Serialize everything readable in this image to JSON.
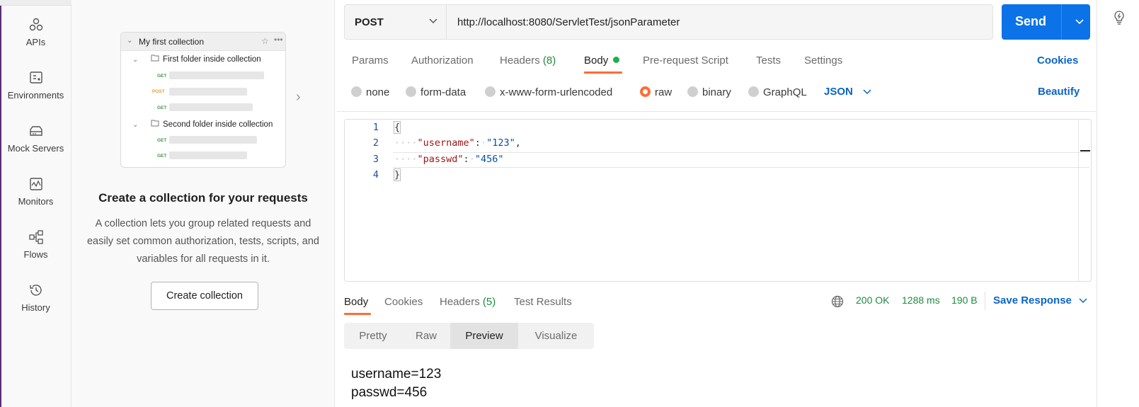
{
  "sidebar": {
    "items": [
      {
        "label": "APIs",
        "icon": "apis-icon"
      },
      {
        "label": "Environments",
        "icon": "environments-icon"
      },
      {
        "label": "Mock Servers",
        "icon": "mock-servers-icon"
      },
      {
        "label": "Monitors",
        "icon": "monitors-icon"
      },
      {
        "label": "Flows",
        "icon": "flows-icon"
      },
      {
        "label": "History",
        "icon": "history-icon"
      }
    ]
  },
  "collection_panel": {
    "illustration": {
      "collection_name": "My first collection",
      "folder1": "First folder inside collection",
      "folder2": "Second folder inside collection",
      "methods": [
        "GET",
        "POST",
        "GET",
        "GET",
        "GET"
      ]
    },
    "title": "Create a collection for your requests",
    "description": "A collection lets you group related requests and easily set common authorization, tests, scripts, and variables for all requests in it.",
    "create_button": "Create collection"
  },
  "request": {
    "method": "POST",
    "url": "http://localhost:8080/ServletTest/jsonParameter",
    "send_label": "Send",
    "tabs": {
      "params": "Params",
      "authorization": "Authorization",
      "headers": "Headers",
      "headers_count": "(8)",
      "body": "Body",
      "pre_request": "Pre-request Script",
      "tests": "Tests",
      "settings": "Settings"
    },
    "cookies_label": "Cookies",
    "body_types": {
      "none": "none",
      "form_data": "form-data",
      "urlencoded": "x-www-form-urlencoded",
      "raw": "raw",
      "binary": "binary",
      "graphql": "GraphQL",
      "selected": "raw"
    },
    "format": "JSON",
    "beautify_label": "Beautify",
    "editor": {
      "line_numbers": [
        "1",
        "2",
        "3",
        "4"
      ],
      "open_brace": "{",
      "close_brace": "}",
      "key1": "\"username\"",
      "val1": "\"123\"",
      "key2": "\"passwd\"",
      "val2": "\"456\""
    }
  },
  "response": {
    "tabs": {
      "body": "Body",
      "cookies": "Cookies",
      "headers": "Headers",
      "headers_count": "(5)",
      "test_results": "Test Results"
    },
    "status": "200 OK",
    "time": "1288 ms",
    "size": "190 B",
    "save_label": "Save Response",
    "views": [
      "Pretty",
      "Raw",
      "Preview",
      "Visualize"
    ],
    "active_view": "Preview",
    "preview_lines": [
      "username=123",
      "passwd=456"
    ]
  },
  "colors": {
    "accent_orange": "#ff6c37",
    "primary_blue": "#0c72e8",
    "link_blue": "#0b64c9",
    "success_green": "#1f8a3f"
  }
}
